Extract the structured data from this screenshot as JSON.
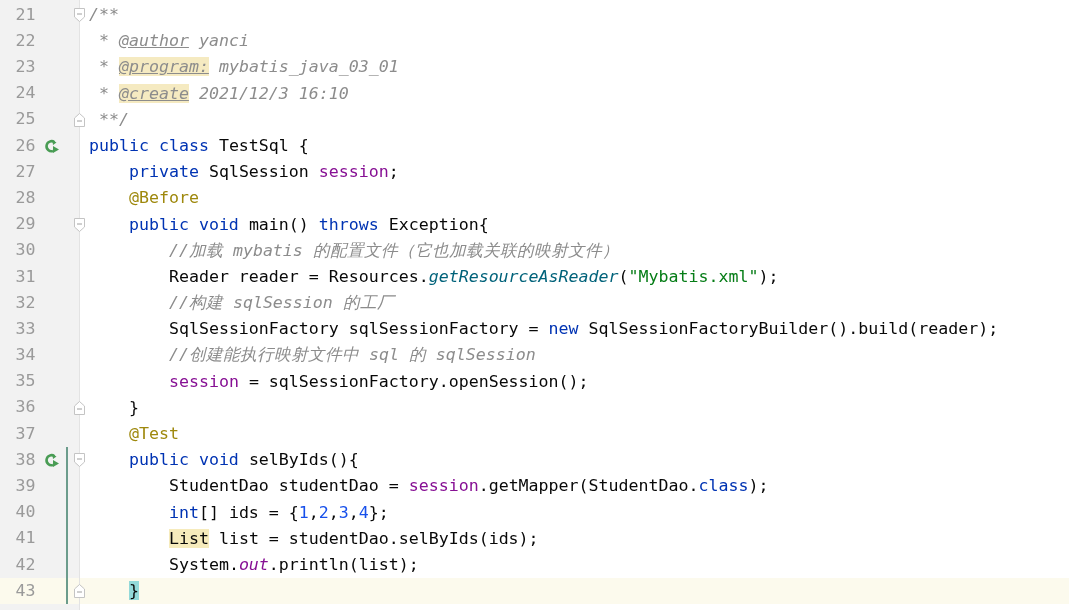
{
  "editor": {
    "lines": [
      {
        "number": "21",
        "run": false,
        "fold_start": true,
        "fold_end": false,
        "modified": false,
        "current": false,
        "tokens": [
          {
            "text": "/**",
            "kind": "comment"
          }
        ]
      },
      {
        "number": "22",
        "run": false,
        "fold_start": false,
        "fold_end": false,
        "modified": false,
        "current": false,
        "tokens": [
          {
            "text": " * ",
            "kind": "comment"
          },
          {
            "text": "@author",
            "kind": "doc-tag"
          },
          {
            "text": " yanci",
            "kind": "comment"
          }
        ]
      },
      {
        "number": "23",
        "run": false,
        "fold_start": false,
        "fold_end": false,
        "modified": false,
        "current": false,
        "tokens": [
          {
            "text": " * ",
            "kind": "comment"
          },
          {
            "text": "@program:",
            "kind": "doc-tag-marked"
          },
          {
            "text": " mybatis_java_03_01",
            "kind": "comment"
          }
        ]
      },
      {
        "number": "24",
        "run": false,
        "fold_start": false,
        "fold_end": false,
        "modified": false,
        "current": false,
        "tokens": [
          {
            "text": " * ",
            "kind": "comment"
          },
          {
            "text": "@create",
            "kind": "doc-tag-marked"
          },
          {
            "text": " 2021/12/3 16:10",
            "kind": "comment"
          }
        ]
      },
      {
        "number": "25",
        "run": false,
        "fold_start": false,
        "fold_end": true,
        "modified": false,
        "current": false,
        "tokens": [
          {
            "text": " **/",
            "kind": "comment"
          }
        ]
      },
      {
        "number": "26",
        "run": true,
        "fold_start": false,
        "fold_end": false,
        "modified": false,
        "current": false,
        "tokens": [
          {
            "text": "public class",
            "kind": "keyword"
          },
          {
            "text": " TestSql {",
            "kind": "plain"
          }
        ]
      },
      {
        "number": "27",
        "run": false,
        "fold_start": false,
        "fold_end": false,
        "modified": false,
        "current": false,
        "tokens": [
          {
            "text": "    private",
            "kind": "keyword"
          },
          {
            "text": " SqlSession ",
            "kind": "plain"
          },
          {
            "text": "session",
            "kind": "field"
          },
          {
            "text": ";",
            "kind": "plain"
          }
        ]
      },
      {
        "number": "28",
        "run": false,
        "fold_start": false,
        "fold_end": false,
        "modified": false,
        "current": false,
        "tokens": [
          {
            "text": "    @Before",
            "kind": "annotation"
          }
        ]
      },
      {
        "number": "29",
        "run": false,
        "fold_start": true,
        "fold_end": false,
        "modified": false,
        "current": false,
        "tokens": [
          {
            "text": "    public void",
            "kind": "keyword"
          },
          {
            "text": " main() ",
            "kind": "plain"
          },
          {
            "text": "throws",
            "kind": "keyword"
          },
          {
            "text": " Exception{",
            "kind": "plain"
          }
        ]
      },
      {
        "number": "30",
        "run": false,
        "fold_start": false,
        "fold_end": false,
        "modified": false,
        "current": false,
        "tokens": [
          {
            "text": "        //加载 mybatis 的配置文件（它也加载关联的映射文件）",
            "kind": "comment"
          }
        ]
      },
      {
        "number": "31",
        "run": false,
        "fold_start": false,
        "fold_end": false,
        "modified": false,
        "current": false,
        "tokens": [
          {
            "text": "        Reader reader = Resources.",
            "kind": "plain"
          },
          {
            "text": "getResourceAsReader",
            "kind": "method"
          },
          {
            "text": "(",
            "kind": "plain"
          },
          {
            "text": "\"Mybatis.xml\"",
            "kind": "string"
          },
          {
            "text": ");",
            "kind": "plain"
          }
        ]
      },
      {
        "number": "32",
        "run": false,
        "fold_start": false,
        "fold_end": false,
        "modified": false,
        "current": false,
        "tokens": [
          {
            "text": "        //构建 sqlSession 的工厂",
            "kind": "comment"
          }
        ]
      },
      {
        "number": "33",
        "run": false,
        "fold_start": false,
        "fold_end": false,
        "modified": false,
        "current": false,
        "tokens": [
          {
            "text": "        SqlSessionFactory sqlSessionFactory = ",
            "kind": "plain"
          },
          {
            "text": "new",
            "kind": "keyword"
          },
          {
            "text": " SqlSessionFactoryBuilder().build(reader);",
            "kind": "plain"
          }
        ]
      },
      {
        "number": "34",
        "run": false,
        "fold_start": false,
        "fold_end": false,
        "modified": false,
        "current": false,
        "tokens": [
          {
            "text": "        //创建能执行映射文件中 sql 的 sqlSession",
            "kind": "comment"
          }
        ]
      },
      {
        "number": "35",
        "run": false,
        "fold_start": false,
        "fold_end": false,
        "modified": false,
        "current": false,
        "tokens": [
          {
            "text": "        session",
            "kind": "field"
          },
          {
            "text": " = sqlSessionFactory.openSession();",
            "kind": "plain"
          }
        ]
      },
      {
        "number": "36",
        "run": false,
        "fold_start": false,
        "fold_end": true,
        "modified": false,
        "current": false,
        "tokens": [
          {
            "text": "    }",
            "kind": "plain"
          }
        ]
      },
      {
        "number": "37",
        "run": false,
        "fold_start": false,
        "fold_end": false,
        "modified": false,
        "current": false,
        "tokens": [
          {
            "text": "    @Test",
            "kind": "annotation"
          }
        ]
      },
      {
        "number": "38",
        "run": true,
        "fold_start": true,
        "fold_end": false,
        "modified": true,
        "current": false,
        "tokens": [
          {
            "text": "    public void",
            "kind": "keyword"
          },
          {
            "text": " selByIds(){",
            "kind": "plain"
          }
        ]
      },
      {
        "number": "39",
        "run": false,
        "fold_start": false,
        "fold_end": false,
        "modified": true,
        "current": false,
        "tokens": [
          {
            "text": "        StudentDao studentDao = ",
            "kind": "plain"
          },
          {
            "text": "session",
            "kind": "field"
          },
          {
            "text": ".getMapper(StudentDao.",
            "kind": "plain"
          },
          {
            "text": "class",
            "kind": "keyword"
          },
          {
            "text": ");",
            "kind": "plain"
          }
        ]
      },
      {
        "number": "40",
        "run": false,
        "fold_start": false,
        "fold_end": false,
        "modified": true,
        "current": false,
        "tokens": [
          {
            "text": "        int",
            "kind": "keyword"
          },
          {
            "text": "[] ids = {",
            "kind": "plain"
          },
          {
            "text": "1",
            "kind": "number"
          },
          {
            "text": ",",
            "kind": "plain"
          },
          {
            "text": "2",
            "kind": "number"
          },
          {
            "text": ",",
            "kind": "plain"
          },
          {
            "text": "3",
            "kind": "number"
          },
          {
            "text": ",",
            "kind": "plain"
          },
          {
            "text": "4",
            "kind": "number"
          },
          {
            "text": "};",
            "kind": "plain"
          }
        ]
      },
      {
        "number": "41",
        "run": false,
        "fold_start": false,
        "fold_end": false,
        "modified": true,
        "current": false,
        "tokens": [
          {
            "text": "        List",
            "kind": "marked"
          },
          {
            "text": " list = studentDao.selByIds(ids);",
            "kind": "plain"
          }
        ]
      },
      {
        "number": "42",
        "run": false,
        "fold_start": false,
        "fold_end": false,
        "modified": true,
        "current": false,
        "tokens": [
          {
            "text": "        System.",
            "kind": "plain"
          },
          {
            "text": "out",
            "kind": "static-field"
          },
          {
            "text": ".println(list);",
            "kind": "plain"
          }
        ]
      },
      {
        "number": "43",
        "run": false,
        "fold_start": false,
        "fold_end": true,
        "modified": true,
        "current": true,
        "tokens": [
          {
            "text": "    }",
            "kind": "brace-match"
          }
        ]
      }
    ]
  }
}
